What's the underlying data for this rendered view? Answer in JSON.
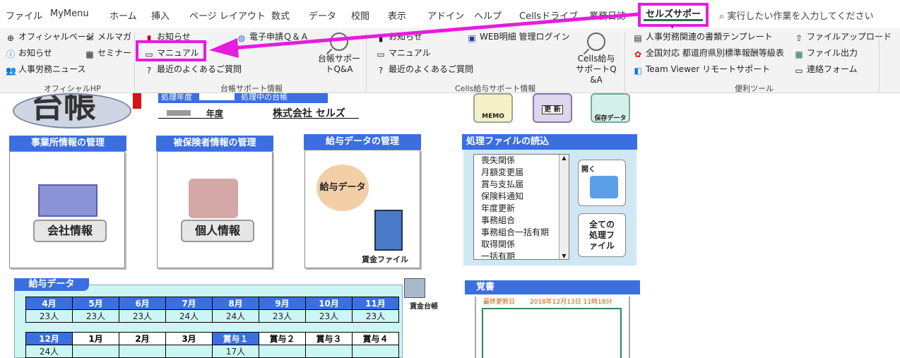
{
  "tabs": [
    "ファイル",
    "MyMenu",
    "ホーム",
    "挿入",
    "ページ レイアウト",
    "数式",
    "データ",
    "校閲",
    "表示",
    "アドイン",
    "ヘルプ",
    "Cellsドライブ",
    "業務日誌"
  ],
  "active_tab": "セルズサポート",
  "tell_me": "実行したい作業を入力してください",
  "ribbon": {
    "official": {
      "items": [
        "オフィシャルページ",
        "お知らせ",
        "人事労務ニュース",
        "メルマガ",
        "セミナー"
      ],
      "group": "オフィシャルHP"
    },
    "daicho": {
      "items": [
        "お知らせ",
        "マニュアル",
        "最近のよくあるご質問",
        "電子申請Ｑ＆Ａ"
      ],
      "big": "台帳サポートQ&A",
      "group": "台帳サポート情報"
    },
    "cells": {
      "items": [
        "お知らせ",
        "マニュアル",
        "最近のよくあるご質問",
        "WEB明細 管理ログイン"
      ],
      "big": "Cells給与サポートQ&A",
      "group": "Cells給与サポート情報"
    },
    "tools": {
      "items": [
        "人事労務関連の書類テンプレート",
        "全国対応 都道府県別標準報酬等級表",
        "Team Viewer リモートサポート",
        "ファイルアップロード",
        "ファイル出力",
        "連絡フォーム"
      ],
      "group": "便利ツール"
    }
  },
  "sheet": {
    "header_row": {
      "processing_year_label": "処理年度",
      "processing_book_label": "処理中の台帳",
      "year_suffix": "年度",
      "company": "株式会社 セルズ"
    },
    "logo_text": "台帳",
    "buttons": {
      "memo": "MEMO",
      "update": "更 新",
      "save": "保存データ"
    },
    "office": {
      "title": "事業所情報の管理",
      "button": "会社情報"
    },
    "insured": {
      "title": "被保険者情報の管理",
      "button": "個人情報"
    },
    "salary_mgmt": {
      "title": "給与データの管理",
      "button": "給与データ",
      "ledger": "賃金ファイル"
    },
    "files": {
      "title": "処理ファイルの読込",
      "items": [
        "喪失関係",
        "月額変更届",
        "賞与支払届",
        "保険料通知",
        "年度更新",
        "事務組合",
        "事務組合一括有期",
        "取得関係",
        "一括有期"
      ],
      "open": "開く",
      "all": "全ての処理ファイル"
    },
    "salary_data": {
      "title": "給与データ",
      "ledger_icon": "賃金台帳",
      "row1_months": [
        "4月",
        "5月",
        "6月",
        "7月",
        "8月",
        "9月",
        "10月",
        "11月"
      ],
      "row1_counts": [
        "23人",
        "23人",
        "23人",
        "24人",
        "24人",
        "23人",
        "23人",
        "23人"
      ],
      "row2_months": [
        "12月",
        "1月",
        "2月",
        "3月",
        "賞与１",
        "賞与２",
        "賞与３",
        "賞与４"
      ],
      "row2_counts": [
        "24人",
        "",
        "",
        "",
        "17人",
        "",
        "",
        ""
      ]
    },
    "memo": {
      "title": "覚書",
      "last_updated_label": "最終更新日",
      "last_updated": "2018年12月13日 11時18分"
    }
  },
  "colors": {
    "highlight": "#e61ce0",
    "sheet_blue": "#3b6fe0",
    "excel_green": "#217346"
  }
}
